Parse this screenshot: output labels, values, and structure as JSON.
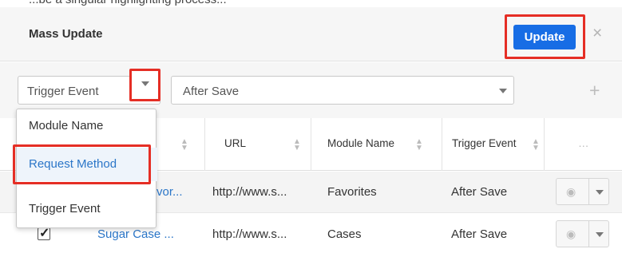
{
  "top_caption": "...be a singular highlighting process...",
  "header": {
    "title": "Mass Update",
    "update_label": "Update",
    "close_glyph": "×"
  },
  "filter": {
    "field_select": "Trigger Event",
    "value_select": "After Save",
    "add_glyph": "+"
  },
  "dropdown": {
    "items": [
      "Module Name",
      "Request Method",
      "Trigger Event"
    ],
    "highlighted": "Request Method"
  },
  "table": {
    "columns": [
      "",
      "URL",
      "Module Name",
      "Trigger Event",
      "…"
    ],
    "rows": [
      {
        "name": "vor...",
        "url": "http://www.s...",
        "module": "Favorites",
        "trigger": "After Save",
        "checked": false
      },
      {
        "name": "Sugar Case ...",
        "url": "http://www.s...",
        "module": "Cases",
        "trigger": "After Save",
        "checked": true
      }
    ]
  },
  "colors": {
    "accent": "#176de5",
    "highlight_border": "#e52e25",
    "link": "#2b76c8"
  },
  "icons": {
    "close": "close-icon",
    "add": "plus-icon",
    "chevron": "chevron-down-icon",
    "sort": "sort-icon",
    "eye": "eye-icon"
  }
}
